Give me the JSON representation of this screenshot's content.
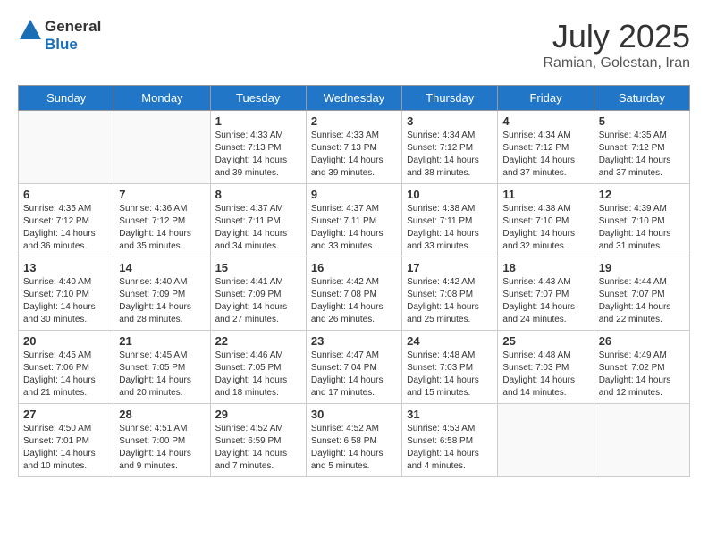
{
  "header": {
    "logo": {
      "general": "General",
      "blue": "Blue"
    },
    "title": "July 2025",
    "location": "Ramian, Golestan, Iran"
  },
  "weekdays": [
    "Sunday",
    "Monday",
    "Tuesday",
    "Wednesday",
    "Thursday",
    "Friday",
    "Saturday"
  ],
  "weeks": [
    [
      {
        "day": "",
        "info": ""
      },
      {
        "day": "",
        "info": ""
      },
      {
        "day": "1",
        "info": "Sunrise: 4:33 AM\nSunset: 7:13 PM\nDaylight: 14 hours and 39 minutes."
      },
      {
        "day": "2",
        "info": "Sunrise: 4:33 AM\nSunset: 7:13 PM\nDaylight: 14 hours and 39 minutes."
      },
      {
        "day": "3",
        "info": "Sunrise: 4:34 AM\nSunset: 7:12 PM\nDaylight: 14 hours and 38 minutes."
      },
      {
        "day": "4",
        "info": "Sunrise: 4:34 AM\nSunset: 7:12 PM\nDaylight: 14 hours and 37 minutes."
      },
      {
        "day": "5",
        "info": "Sunrise: 4:35 AM\nSunset: 7:12 PM\nDaylight: 14 hours and 37 minutes."
      }
    ],
    [
      {
        "day": "6",
        "info": "Sunrise: 4:35 AM\nSunset: 7:12 PM\nDaylight: 14 hours and 36 minutes."
      },
      {
        "day": "7",
        "info": "Sunrise: 4:36 AM\nSunset: 7:12 PM\nDaylight: 14 hours and 35 minutes."
      },
      {
        "day": "8",
        "info": "Sunrise: 4:37 AM\nSunset: 7:11 PM\nDaylight: 14 hours and 34 minutes."
      },
      {
        "day": "9",
        "info": "Sunrise: 4:37 AM\nSunset: 7:11 PM\nDaylight: 14 hours and 33 minutes."
      },
      {
        "day": "10",
        "info": "Sunrise: 4:38 AM\nSunset: 7:11 PM\nDaylight: 14 hours and 33 minutes."
      },
      {
        "day": "11",
        "info": "Sunrise: 4:38 AM\nSunset: 7:10 PM\nDaylight: 14 hours and 32 minutes."
      },
      {
        "day": "12",
        "info": "Sunrise: 4:39 AM\nSunset: 7:10 PM\nDaylight: 14 hours and 31 minutes."
      }
    ],
    [
      {
        "day": "13",
        "info": "Sunrise: 4:40 AM\nSunset: 7:10 PM\nDaylight: 14 hours and 30 minutes."
      },
      {
        "day": "14",
        "info": "Sunrise: 4:40 AM\nSunset: 7:09 PM\nDaylight: 14 hours and 28 minutes."
      },
      {
        "day": "15",
        "info": "Sunrise: 4:41 AM\nSunset: 7:09 PM\nDaylight: 14 hours and 27 minutes."
      },
      {
        "day": "16",
        "info": "Sunrise: 4:42 AM\nSunset: 7:08 PM\nDaylight: 14 hours and 26 minutes."
      },
      {
        "day": "17",
        "info": "Sunrise: 4:42 AM\nSunset: 7:08 PM\nDaylight: 14 hours and 25 minutes."
      },
      {
        "day": "18",
        "info": "Sunrise: 4:43 AM\nSunset: 7:07 PM\nDaylight: 14 hours and 24 minutes."
      },
      {
        "day": "19",
        "info": "Sunrise: 4:44 AM\nSunset: 7:07 PM\nDaylight: 14 hours and 22 minutes."
      }
    ],
    [
      {
        "day": "20",
        "info": "Sunrise: 4:45 AM\nSunset: 7:06 PM\nDaylight: 14 hours and 21 minutes."
      },
      {
        "day": "21",
        "info": "Sunrise: 4:45 AM\nSunset: 7:05 PM\nDaylight: 14 hours and 20 minutes."
      },
      {
        "day": "22",
        "info": "Sunrise: 4:46 AM\nSunset: 7:05 PM\nDaylight: 14 hours and 18 minutes."
      },
      {
        "day": "23",
        "info": "Sunrise: 4:47 AM\nSunset: 7:04 PM\nDaylight: 14 hours and 17 minutes."
      },
      {
        "day": "24",
        "info": "Sunrise: 4:48 AM\nSunset: 7:03 PM\nDaylight: 14 hours and 15 minutes."
      },
      {
        "day": "25",
        "info": "Sunrise: 4:48 AM\nSunset: 7:03 PM\nDaylight: 14 hours and 14 minutes."
      },
      {
        "day": "26",
        "info": "Sunrise: 4:49 AM\nSunset: 7:02 PM\nDaylight: 14 hours and 12 minutes."
      }
    ],
    [
      {
        "day": "27",
        "info": "Sunrise: 4:50 AM\nSunset: 7:01 PM\nDaylight: 14 hours and 10 minutes."
      },
      {
        "day": "28",
        "info": "Sunrise: 4:51 AM\nSunset: 7:00 PM\nDaylight: 14 hours and 9 minutes."
      },
      {
        "day": "29",
        "info": "Sunrise: 4:52 AM\nSunset: 6:59 PM\nDaylight: 14 hours and 7 minutes."
      },
      {
        "day": "30",
        "info": "Sunrise: 4:52 AM\nSunset: 6:58 PM\nDaylight: 14 hours and 5 minutes."
      },
      {
        "day": "31",
        "info": "Sunrise: 4:53 AM\nSunset: 6:58 PM\nDaylight: 14 hours and 4 minutes."
      },
      {
        "day": "",
        "info": ""
      },
      {
        "day": "",
        "info": ""
      }
    ]
  ]
}
